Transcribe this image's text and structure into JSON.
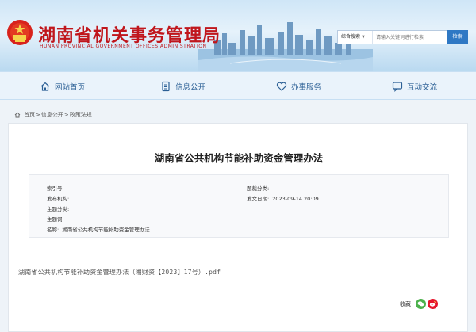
{
  "site": {
    "title": "湖南省机关事务管理局",
    "subtitle": "HUNAN PROVINCIAL GOVERNMENT OFFICES ADMINISTRATION"
  },
  "search": {
    "scope": "综合搜索",
    "placeholder": "请输入关键词进行检索",
    "button": "检索"
  },
  "nav": {
    "items": [
      {
        "label": "网站首页",
        "icon": "home-icon"
      },
      {
        "label": "信息公开",
        "icon": "document-icon"
      },
      {
        "label": "办事服务",
        "icon": "heart-icon"
      },
      {
        "label": "互动交流",
        "icon": "chat-icon"
      }
    ]
  },
  "breadcrumb": {
    "home": "首页",
    "sep": ">",
    "level1": "信息公开",
    "level2": "政策法规"
  },
  "article": {
    "title": "湖南省公共机构节能补助资金管理办法",
    "meta": {
      "index_label": "索引号:",
      "index_value": "",
      "category_label": "题裁分类:",
      "category_value": "",
      "org_label": "发布机构:",
      "org_value": "",
      "date_label": "发文日期:",
      "date_value": "2023-09-14 20:09",
      "topic_label": "主题分类:",
      "topic_value": "",
      "keyword_label": "主题词:",
      "keyword_value": "",
      "name_label": "名称:",
      "name_value": "湖南省公共机构节能补助资金管理办法"
    },
    "attachment": "湖南省公共机构节能补助资金管理办法（湘财资【2023】17号）.pdf"
  },
  "share": {
    "label": "收藏",
    "icons": [
      "wechat-icon",
      "weibo-icon"
    ]
  },
  "colors": {
    "title_red": "#c0161c",
    "nav_blue": "#2b5f95",
    "search_button": "#2f78c4"
  }
}
